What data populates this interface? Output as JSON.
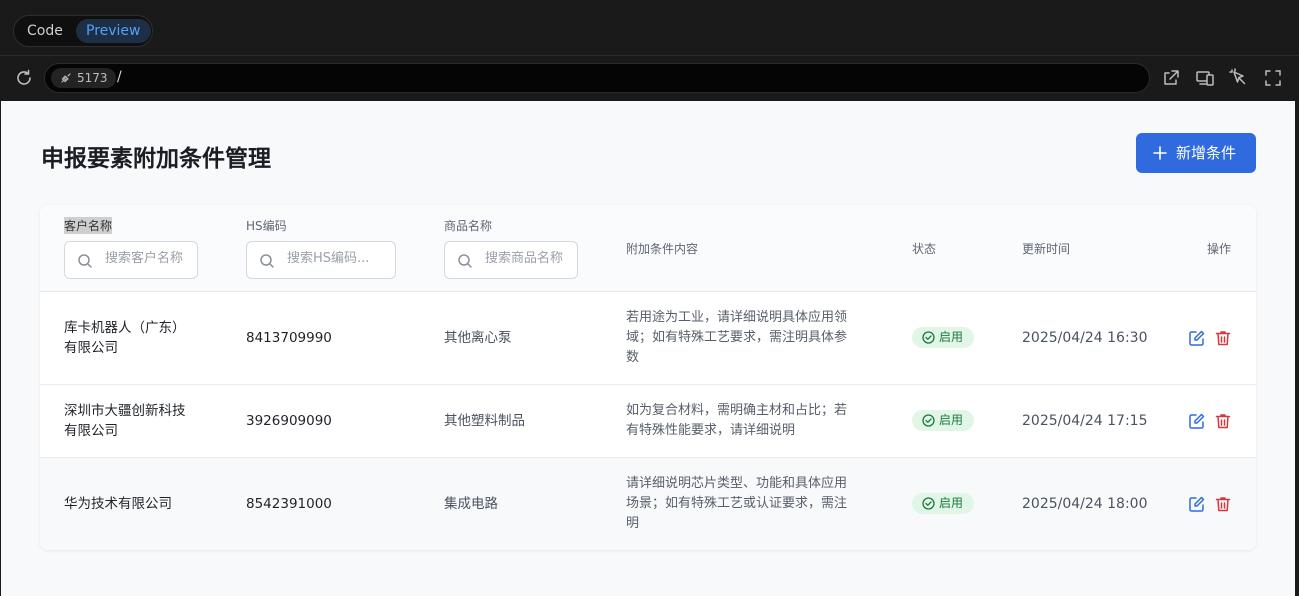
{
  "chrome": {
    "toggle": {
      "code_label": "Code",
      "preview_label": "Preview"
    },
    "url": {
      "port": "5173",
      "path": "/"
    }
  },
  "page": {
    "title": "申报要素附加条件管理",
    "add_button_label": "新增条件"
  },
  "table": {
    "columns": {
      "customer": "客户名称",
      "hs_code": "HS编码",
      "product": "商品名称",
      "condition": "附加条件内容",
      "status": "状态",
      "updated": "更新时间",
      "actions": "操作"
    },
    "filters": {
      "customer_placeholder": "搜索客户名称",
      "hs_placeholder": "搜索HS编码...",
      "product_placeholder": "搜索商品名称"
    },
    "rows": [
      {
        "customer_l1": "库卡机器人（广东）",
        "customer_l2": "有限公司",
        "hs_code": "8413709990",
        "product": "其他离心泵",
        "cond_l1": "若用途为工业，请详细说明具体应用领",
        "cond_l2": "域；如有特殊工艺要求，需注明具体参",
        "cond_l3": "数",
        "status": "启用",
        "updated": "2025/04/24 16:30"
      },
      {
        "customer_l1": "深圳市大疆创新科技",
        "customer_l2": "有限公司",
        "hs_code": "3926909090",
        "product": "其他塑料制品",
        "cond_l1": "如为复合材料，需明确主材和占比；若",
        "cond_l2": "有特殊性能要求，请详细说明",
        "status": "启用",
        "updated": "2025/04/24 17:15"
      },
      {
        "customer_l1": "华为技术有限公司",
        "hs_code": "8542391000",
        "product": "集成电路",
        "cond_l1": "请详细说明芯片类型、功能和具体应用",
        "cond_l2": "场景；如有特殊工艺或认证要求，需注",
        "cond_l3": "明",
        "status": "启用",
        "updated": "2025/04/24 18:00"
      }
    ]
  },
  "colors": {
    "accent": "#2f6bdf",
    "status_bg": "#e2f6e8",
    "status_text": "#1a7a3c",
    "delete": "#d9363e",
    "edit": "#2f6bdf"
  },
  "icons": [
    "refresh-icon",
    "plug-icon",
    "external-link-icon",
    "devices-icon",
    "inspect-icon",
    "fullscreen-icon",
    "plus-icon",
    "search-icon",
    "check-circle-icon",
    "edit-icon",
    "trash-icon"
  ]
}
